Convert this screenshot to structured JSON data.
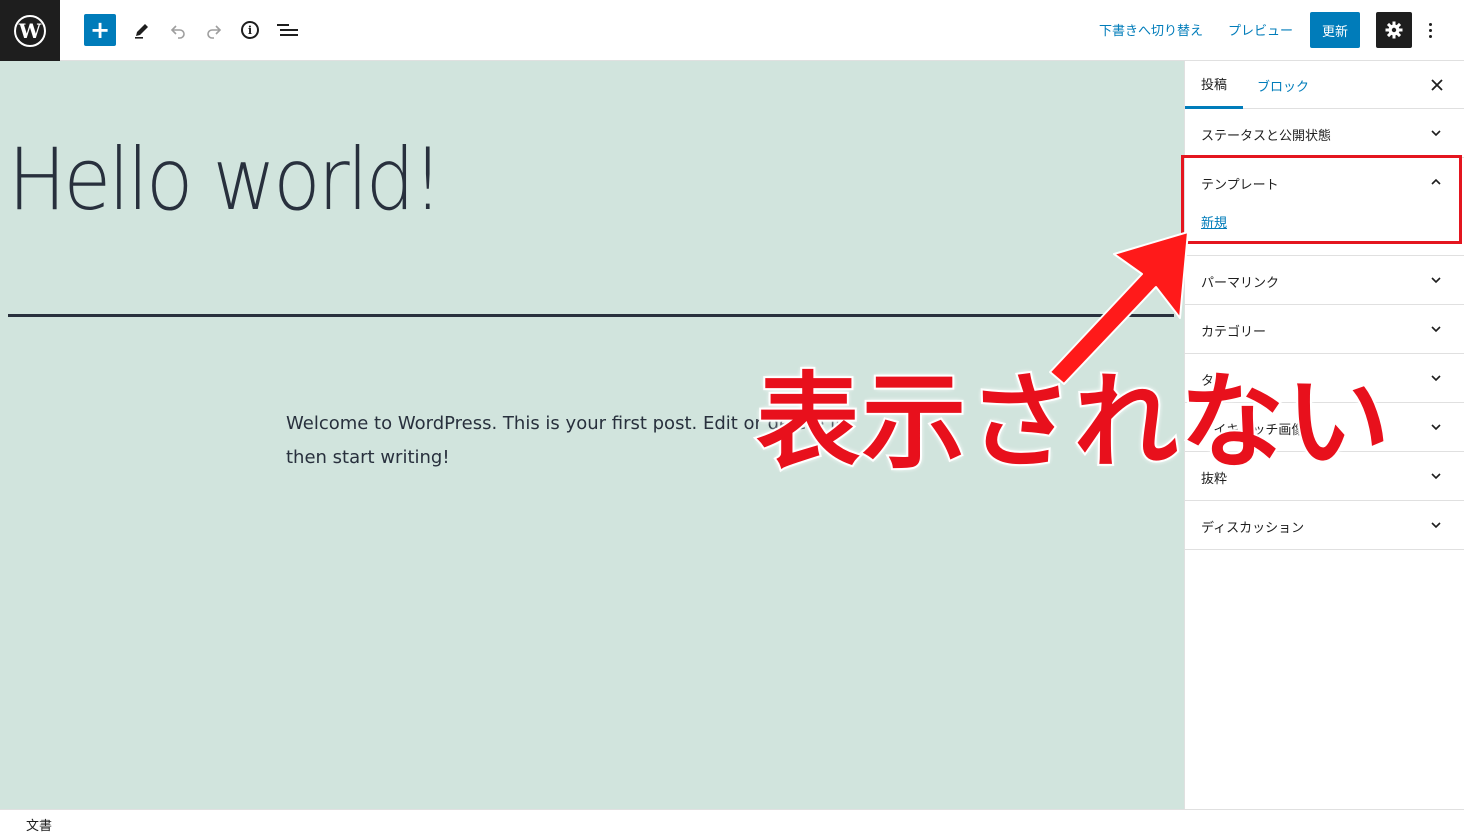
{
  "toolbar": {
    "add_icon": "plus-icon",
    "draft_label": "下書きへ切り替え",
    "preview_label": "プレビュー",
    "update_label": "更新"
  },
  "editor": {
    "title": "Hello world!",
    "body": "Welcome to WordPress. This is your first post. Edit or delete it, then start writing!"
  },
  "sidebar": {
    "tabs": [
      {
        "label": "投稿",
        "active": true
      },
      {
        "label": "ブロック",
        "active": false
      }
    ],
    "panels": [
      {
        "label": "ステータスと公開状態",
        "expanded": false
      },
      {
        "label": "テンプレート",
        "expanded": true,
        "value": "新規"
      },
      {
        "label": "パーマリンク",
        "expanded": false
      },
      {
        "label": "カテゴリー",
        "expanded": false
      },
      {
        "label": "タグ",
        "expanded": false
      },
      {
        "label": "アイキャッチ画像",
        "expanded": false
      },
      {
        "label": "抜粋",
        "expanded": false
      },
      {
        "label": "ディスカッション",
        "expanded": false
      }
    ]
  },
  "statusbar": {
    "breadcrumb": "文書"
  },
  "annotation": {
    "text": "表示されない",
    "color": "#e8101c"
  },
  "colors": {
    "accent": "#007cba",
    "canvas_bg": "#d1e4dd",
    "text_dark": "#28303d"
  }
}
